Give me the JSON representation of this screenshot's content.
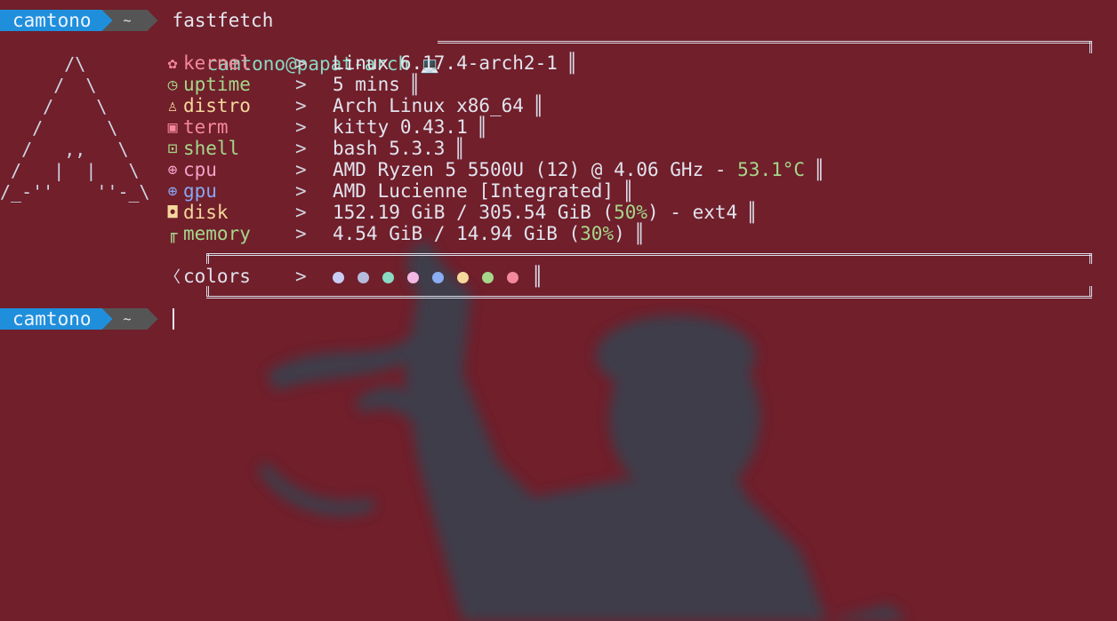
{
  "colors": {
    "background": "#701f2b",
    "prompt_user_bg": "#1f8fdc",
    "prompt_dir_bg": "#555555",
    "kernel": "#f4899b",
    "uptime": "#a6d78b",
    "distro": "#f6d79c",
    "term": "#f4899b",
    "shell": "#a6d78b",
    "cpu": "#f4a1c8",
    "gpu": "#8aa7f2",
    "disk": "#f6d79c",
    "memory": "#a6d78b",
    "header": "#8ad9c3",
    "highlight": "#a6d78b"
  },
  "prompt": {
    "user": "camtono",
    "dir": "~",
    "command": "fastfetch"
  },
  "prompt2": {
    "user": "camtono",
    "dir": "~"
  },
  "header": {
    "user_host": "camtono@papat-arch",
    "icon": "💻"
  },
  "logo": "      /\\\n     /  \\\n    /    \\\n   /      \\\n  /   ,,   \\\n /   |  |   \\\n/_-''    ''-_\\",
  "info": [
    {
      "icon": "gear-icon",
      "glyph": "✿",
      "label": "kernel",
      "value": "Linux 6.17.4-arch2-1"
    },
    {
      "icon": "clock-icon",
      "glyph": "◷",
      "label": "uptime",
      "value": "5 mins"
    },
    {
      "icon": "linux-icon",
      "glyph": "♙",
      "label": "distro",
      "value": "Arch Linux x86_64"
    },
    {
      "icon": "terminal-icon",
      "glyph": "▣",
      "label": "term",
      "value": "kitty 0.43.1"
    },
    {
      "icon": "shell-icon",
      "glyph": "⊡",
      "label": "shell",
      "value": "bash 5.3.3"
    },
    {
      "icon": "cpu-icon",
      "glyph": "⊕",
      "label": "cpu",
      "value_pre": "AMD Ryzen 5 5500U (12) @ 4.06 GHz - ",
      "value_hl": "53.1°C",
      "value_post": ""
    },
    {
      "icon": "gpu-icon",
      "glyph": "⊕",
      "label": "gpu",
      "value": "AMD Lucienne [Integrated]"
    },
    {
      "icon": "disk-icon",
      "glyph": "◘",
      "label": "disk",
      "value_pre": "152.19 GiB / 305.54 GiB (",
      "value_hl": "50%",
      "value_post": ") - ext4"
    },
    {
      "icon": "memory-icon",
      "glyph": "╓",
      "label": "memory",
      "value_pre": "4.54 GiB / 14.94 GiB (",
      "value_hl": "30%",
      "value_post": ")"
    }
  ],
  "colors_row": {
    "icon": "chevron-left-icon",
    "glyph": "〈",
    "label": "colors",
    "dots": [
      "#c9cdf5",
      "#b6bbdc",
      "#8ad9c3",
      "#f4b8e4",
      "#8aadf4",
      "#f6d79c",
      "#a6d78b",
      "#f4899b"
    ]
  },
  "arrow": ">",
  "pipe": "║"
}
